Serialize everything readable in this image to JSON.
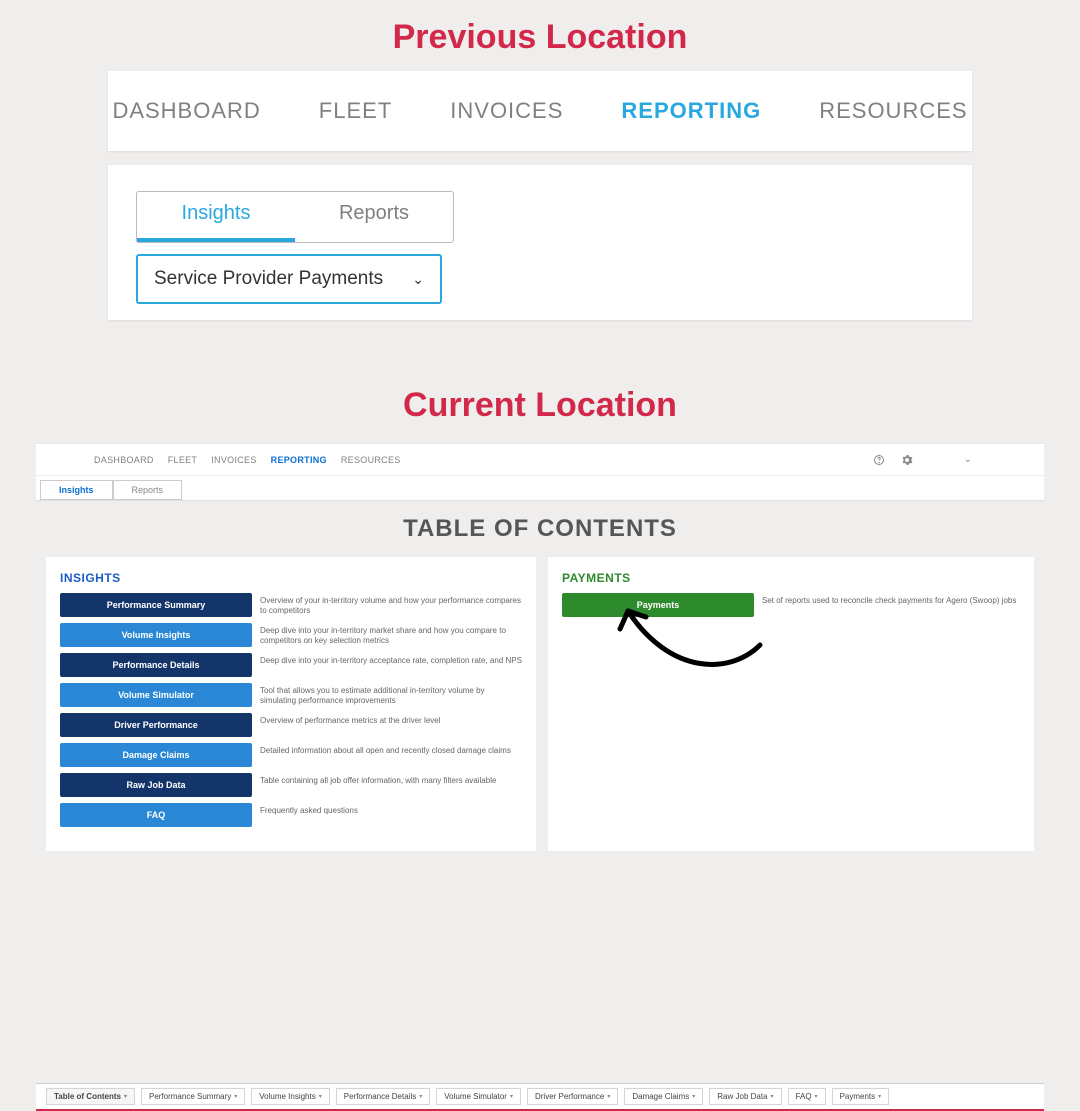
{
  "sections": {
    "previous_title": "Previous Location",
    "current_title": "Current Location"
  },
  "prev_nav": {
    "dashboard": "DASHBOARD",
    "fleet": "FLEET",
    "invoices": "INVOICES",
    "reporting": "REPORTING",
    "resources": "RESOURCES"
  },
  "prev_subtabs": {
    "insights": "Insights",
    "reports": "Reports"
  },
  "prev_select": {
    "value": "Service Provider Payments"
  },
  "curr_nav": {
    "dashboard": "DASHBOARD",
    "fleet": "FLEET",
    "invoices": "INVOICES",
    "reporting": "REPORTING",
    "resources": "RESOURCES"
  },
  "curr_subtabs": {
    "insights": "Insights",
    "reports": "Reports"
  },
  "toc_title": "TABLE OF CONTENTS",
  "insights_panel": {
    "heading": "INSIGHTS",
    "items": [
      {
        "label": "Performance Summary",
        "desc": "Overview of your in-territory volume and how your performance compares to competitors",
        "tone": "dark"
      },
      {
        "label": "Volume Insights",
        "desc": "Deep dive into your in-territory market share and how you compare to competitors on key selection metrics",
        "tone": "light"
      },
      {
        "label": "Performance Details",
        "desc": "Deep dive into your in-territory acceptance rate, completion rate, and NPS",
        "tone": "dark"
      },
      {
        "label": "Volume Simulator",
        "desc": "Tool that allows you to estimate additional in-territory volume by simulating performance improvements",
        "tone": "light"
      },
      {
        "label": "Driver Performance",
        "desc": "Overview of performance metrics at the driver level",
        "tone": "dark"
      },
      {
        "label": "Damage Claims",
        "desc": "Detailed information about all open and recently closed damage claims",
        "tone": "light"
      },
      {
        "label": "Raw Job Data",
        "desc": "Table containing all job offer information, with many filters available",
        "tone": "dark"
      },
      {
        "label": "FAQ",
        "desc": "Frequently asked questions",
        "tone": "light"
      }
    ]
  },
  "payments_panel": {
    "heading": "PAYMENTS",
    "button": "Payments",
    "desc": "Set of reports used to reconcile check payments for Agero (Swoop) jobs"
  },
  "bottom_tabs": [
    "Table of Contents",
    "Performance Summary",
    "Volume Insights",
    "Performance Details",
    "Volume Simulator",
    "Driver Performance",
    "Damage Claims",
    "Raw Job Data",
    "FAQ",
    "Payments"
  ]
}
